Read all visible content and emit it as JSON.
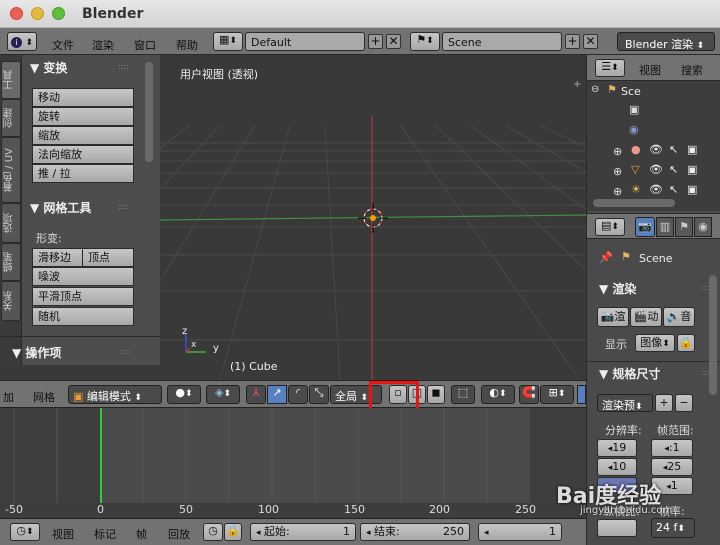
{
  "window": {
    "title": "Blender"
  },
  "infobar": {
    "menus": [
      "文件",
      "渲染",
      "窗口",
      "帮助"
    ],
    "layout": "Default",
    "scene": "Scene",
    "engine": "Blender 渲染"
  },
  "toolshelf": {
    "tabs": [
      "工具",
      "创建",
      "着色 / UV",
      "选项",
      "蜡笔",
      "关系"
    ],
    "transform": {
      "header": "▼ 变换",
      "buttons": [
        "移动",
        "旋转",
        "缩放",
        "法向缩放",
        "推 / 拉"
      ]
    },
    "mesh_tools": {
      "header": "▼ 网格工具",
      "deform_label": "形变:",
      "slide_edge": "滑移边",
      "vertex": "顶点",
      "noise": "噪波",
      "smooth_vertex": "平滑顶点",
      "random": "随机"
    },
    "operator": {
      "header": "▼ 操作项"
    }
  },
  "viewport": {
    "view_label": "用户视图 (透视)",
    "object_label": "(1) Cube",
    "axis_x": "x",
    "axis_y": "y",
    "axis_z": "z"
  },
  "outliner": {
    "view": "视图",
    "search": "搜索",
    "scene": "Sce"
  },
  "properties": {
    "scene": "Scene",
    "render_header": "▼ 渲染",
    "render_btn": "渲",
    "anim_btn": "动",
    "audio_btn": "音",
    "display_label": "显示",
    "display_value": "图像",
    "dims_header": "▼ 规格尺寸",
    "preset": "渲染预",
    "res_label": "分辨率:",
    "frame_range_label": "帧范围:",
    "res_x": "19",
    "res_y": "10",
    "res_pct": "",
    "fr_start": ":1",
    "fr_end": "25",
    "fr_step": "1",
    "aspect_label": "纵横比:",
    "fps_label": "帧率:",
    "fps_value": "24 f"
  },
  "viewport_header": {
    "add": "加",
    "mesh": "网格",
    "mode": "编辑模式",
    "pivot": "全局"
  },
  "timeline": {
    "ticks": [
      "-50",
      "0",
      "50",
      "100",
      "150",
      "200",
      "250"
    ]
  },
  "timeline_header": {
    "menus": [
      "视图",
      "标记",
      "帧",
      "回放"
    ],
    "start_label": "起始:",
    "start_value": "1",
    "end_label": "结束:",
    "end_value": "250",
    "current": "1"
  },
  "watermark": {
    "logo": "Bai度经验",
    "url": "jingyan.baidu.com"
  }
}
